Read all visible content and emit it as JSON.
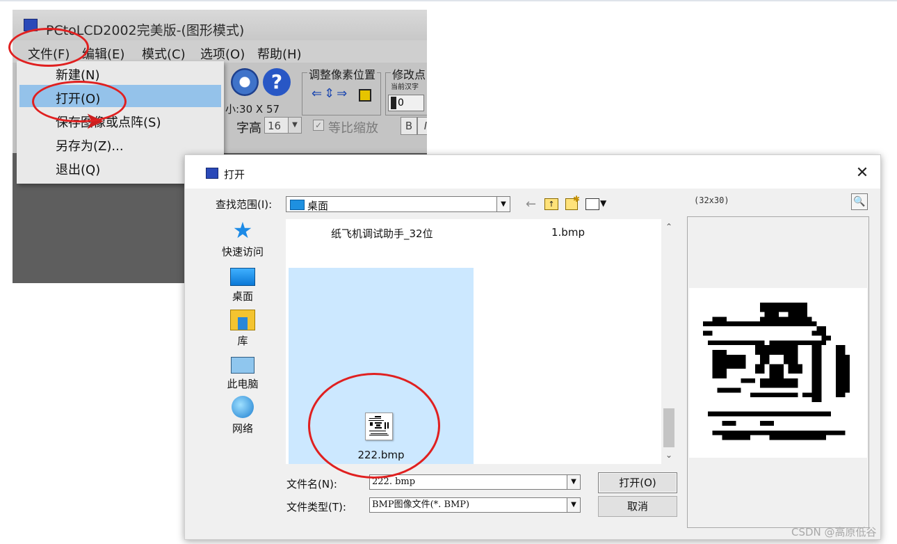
{
  "background_app": {
    "title": "PCtoLCD2002完美版-(图形模式)",
    "menu": [
      "文件(F)",
      "编辑(E)",
      "模式(C)",
      "选项(O)",
      "帮助(H)"
    ],
    "file_menu": [
      "新建(N)",
      "打开(O)",
      "保存图像或点阵(S)",
      "另存为(Z)...",
      "退出(Q)"
    ],
    "size_text": "小:30 X 57",
    "adjust_pos_label": "调整像素位置",
    "modify_label": "修改点",
    "modify_sub": "当前汉字",
    "stepper_value": "0",
    "font_height_label": "字高",
    "font_height_value": "16",
    "scale_label": "等比缩放",
    "bold_label": "B",
    "italic_label": "I"
  },
  "dialog": {
    "title": "打开",
    "close_glyph": "✕",
    "look_in_label": "查找范围(I):",
    "look_in_value": "桌面",
    "sidebar": [
      "快速访问",
      "桌面",
      "库",
      "此电脑",
      "网络"
    ],
    "files_top": [
      "纸飞机调试助手_32位",
      "1.bmp"
    ],
    "selected_file": "222.bmp",
    "file_name_label": "文件名(N):",
    "file_name_value": "222. bmp",
    "file_type_label": "文件类型(T):",
    "file_type_value": "BMP图像文件(*. BMP)",
    "open_button": "打开(O)",
    "cancel_button": "取消",
    "preview_size": "(32x30)"
  },
  "watermark": "CSDN @高原低谷",
  "colors": {
    "selection": "#cce8ff",
    "annotation_ring": "#e02020",
    "menu_highlight": "#94c2ea"
  }
}
